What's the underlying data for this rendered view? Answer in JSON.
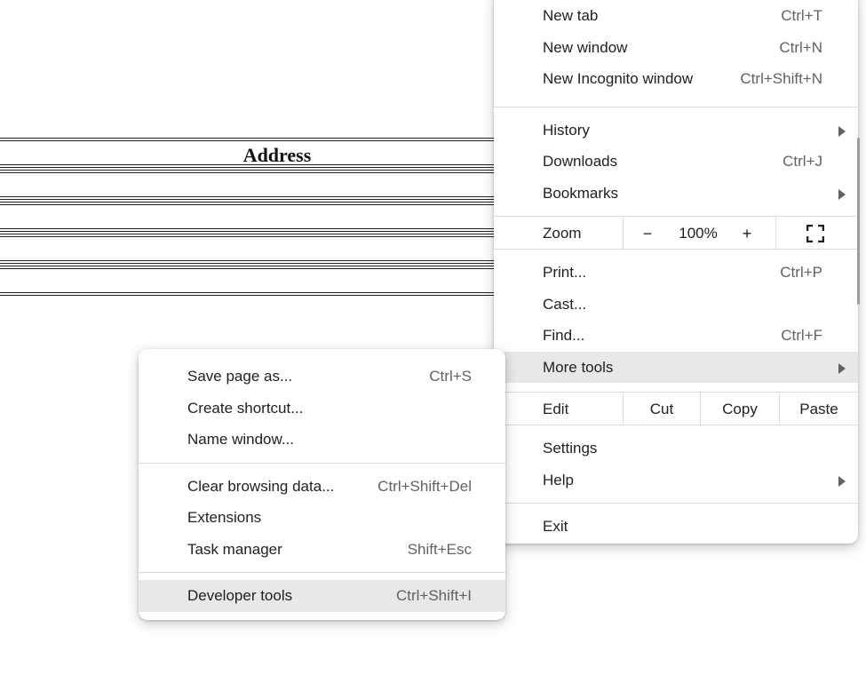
{
  "page": {
    "table_header": "Address"
  },
  "main_menu": {
    "group1": [
      {
        "label": "New tab",
        "shortcut": "Ctrl+T"
      },
      {
        "label": "New window",
        "shortcut": "Ctrl+N"
      },
      {
        "label": "New Incognito window",
        "shortcut": "Ctrl+Shift+N"
      }
    ],
    "history": {
      "label": "History"
    },
    "downloads": {
      "label": "Downloads",
      "shortcut": "Ctrl+J"
    },
    "bookmarks": {
      "label": "Bookmarks"
    },
    "zoom": {
      "label": "Zoom",
      "minus": "−",
      "value": "100%",
      "plus": "+"
    },
    "print": {
      "label": "Print...",
      "shortcut": "Ctrl+P"
    },
    "cast": {
      "label": "Cast..."
    },
    "find": {
      "label": "Find...",
      "shortcut": "Ctrl+F"
    },
    "more_tools": {
      "label": "More tools"
    },
    "edit": {
      "label": "Edit",
      "cut": "Cut",
      "copy": "Copy",
      "paste": "Paste"
    },
    "settings": {
      "label": "Settings"
    },
    "help": {
      "label": "Help"
    },
    "exit": {
      "label": "Exit"
    }
  },
  "sub_menu": {
    "save_page": {
      "label": "Save page as...",
      "shortcut": "Ctrl+S"
    },
    "create_shortcut": {
      "label": "Create shortcut..."
    },
    "name_window": {
      "label": "Name window..."
    },
    "clear_data": {
      "label": "Clear browsing data...",
      "shortcut": "Ctrl+Shift+Del"
    },
    "extensions": {
      "label": "Extensions"
    },
    "task_manager": {
      "label": "Task manager",
      "shortcut": "Shift+Esc"
    },
    "dev_tools": {
      "label": "Developer tools",
      "shortcut": "Ctrl+Shift+I"
    }
  }
}
